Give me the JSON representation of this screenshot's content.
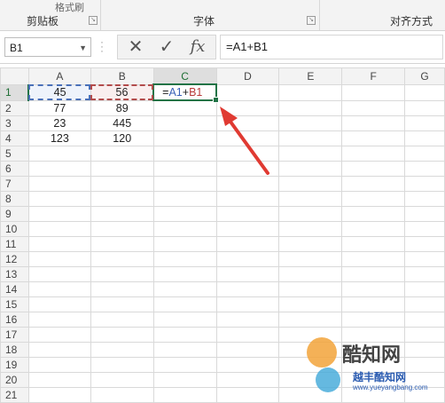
{
  "ribbon": {
    "top_fragment": "格式刷",
    "groups": [
      {
        "label": "剪贴板"
      },
      {
        "label": "字体"
      },
      {
        "label": "对齐方式"
      }
    ]
  },
  "formula_bar": {
    "name_box": "B1",
    "cancel_icon": "✕",
    "enter_icon": "✓",
    "fx_label": "fx",
    "formula": "=A1+B1"
  },
  "columns": [
    "A",
    "B",
    "C",
    "D",
    "E",
    "F",
    "G"
  ],
  "rows": [
    {
      "num": "1",
      "cells": [
        "45",
        "56",
        "",
        "",
        "",
        "",
        ""
      ]
    },
    {
      "num": "2",
      "cells": [
        "77",
        "89",
        "",
        "",
        "",
        "",
        ""
      ]
    },
    {
      "num": "3",
      "cells": [
        "23",
        "445",
        "",
        "",
        "",
        "",
        ""
      ]
    },
    {
      "num": "4",
      "cells": [
        "123",
        "120",
        "",
        "",
        "",
        "",
        ""
      ]
    },
    {
      "num": "5",
      "cells": [
        "",
        "",
        "",
        "",
        "",
        "",
        ""
      ]
    },
    {
      "num": "6",
      "cells": [
        "",
        "",
        "",
        "",
        "",
        "",
        ""
      ]
    },
    {
      "num": "7",
      "cells": [
        "",
        "",
        "",
        "",
        "",
        "",
        ""
      ]
    },
    {
      "num": "8",
      "cells": [
        "",
        "",
        "",
        "",
        "",
        "",
        ""
      ]
    },
    {
      "num": "9",
      "cells": [
        "",
        "",
        "",
        "",
        "",
        "",
        ""
      ]
    },
    {
      "num": "10",
      "cells": [
        "",
        "",
        "",
        "",
        "",
        "",
        ""
      ]
    },
    {
      "num": "11",
      "cells": [
        "",
        "",
        "",
        "",
        "",
        "",
        ""
      ]
    },
    {
      "num": "12",
      "cells": [
        "",
        "",
        "",
        "",
        "",
        "",
        ""
      ]
    },
    {
      "num": "13",
      "cells": [
        "",
        "",
        "",
        "",
        "",
        "",
        ""
      ]
    },
    {
      "num": "14",
      "cells": [
        "",
        "",
        "",
        "",
        "",
        "",
        ""
      ]
    },
    {
      "num": "15",
      "cells": [
        "",
        "",
        "",
        "",
        "",
        "",
        ""
      ]
    },
    {
      "num": "16",
      "cells": [
        "",
        "",
        "",
        "",
        "",
        "",
        ""
      ]
    },
    {
      "num": "17",
      "cells": [
        "",
        "",
        "",
        "",
        "",
        "",
        ""
      ]
    },
    {
      "num": "18",
      "cells": [
        "",
        "",
        "",
        "",
        "",
        "",
        ""
      ]
    },
    {
      "num": "19",
      "cells": [
        "",
        "",
        "",
        "",
        "",
        "",
        ""
      ]
    },
    {
      "num": "20",
      "cells": [
        "",
        "",
        "",
        "",
        "",
        "",
        ""
      ]
    },
    {
      "num": "21",
      "cells": [
        "",
        "",
        "",
        "",
        "",
        "",
        ""
      ]
    }
  ],
  "active_cell_formula": {
    "eq": "=",
    "ref_a": "A1",
    "plus": "+",
    "ref_b": "B1"
  },
  "watermark": {
    "brand": "酷知网",
    "sub": "越丰酷知网",
    "url": "www.yueyangbang.com"
  },
  "colors": {
    "excel_green": "#217346",
    "ref_a_color": "#3a63b8",
    "ref_b_color": "#b83a3a",
    "arrow_red": "#e03a32"
  }
}
